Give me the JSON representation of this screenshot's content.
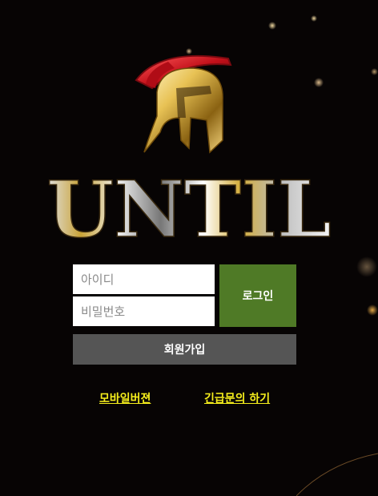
{
  "brand": {
    "name": "UNTIL"
  },
  "login": {
    "id_placeholder": "아이디",
    "password_placeholder": "비밀번호",
    "login_button": "로그인",
    "signup_button": "회원가입"
  },
  "links": {
    "mobile_version": "모바일버젼",
    "urgent_inquiry": "긴급문의 하기"
  },
  "colors": {
    "background": "#070404",
    "login_button": "#4f7a26",
    "signup_button": "#555555",
    "link": "#f5ee1c"
  },
  "icons": [
    "spartan-helmet-icon"
  ]
}
